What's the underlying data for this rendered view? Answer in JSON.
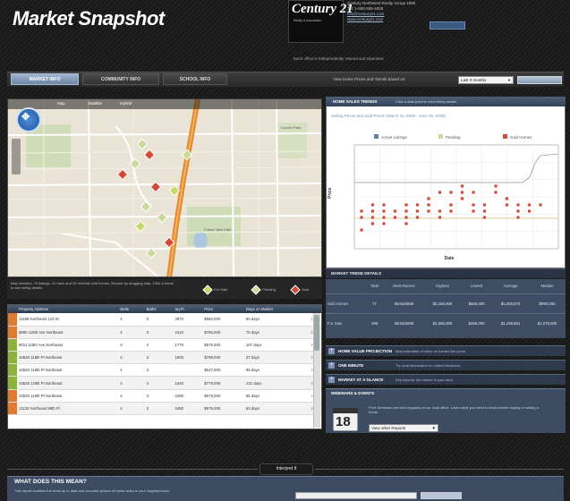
{
  "header": {
    "title": "Market Snapshot",
    "logo_text": "Century 21",
    "logo_sub": "Realty & Associates",
    "agent_lines": [
      "Century Northwest Realty Group 1980",
      "Tel: 1-800-555-4925"
    ],
    "agent_links": [
      "info@century21.com",
      "www.century21.com"
    ],
    "agent_button": "",
    "office_note": "Each office is Independently Owned and Operated"
  },
  "tabs": [
    {
      "label": "MARKET INFO",
      "active": true
    },
    {
      "label": "COMMUNITY INFO",
      "active": false
    },
    {
      "label": "SCHOOL INFO",
      "active": false
    }
  ],
  "range": {
    "label": "View Home Prices and Trends based on:",
    "selected": "Last 3 months",
    "update_label": ""
  },
  "map": {
    "tabs": [
      "Map",
      "Satellite",
      "Hybrid"
    ],
    "place_labels": [
      "Lincoln Park",
      "Forest View Park"
    ],
    "footer_text": "Map includes: 75 listings, 41 have and 20 recently sold homes. Browse by dragging map. Click a home to see listing details.",
    "legend": [
      {
        "label": "For Sale",
        "color": "#c7d66a"
      },
      {
        "label": "Pending",
        "color": "#cbd99a"
      },
      {
        "label": "Sold",
        "color": "#d14a3a"
      }
    ]
  },
  "chart_panel": {
    "header": "HOME SALES TRENDS",
    "header_sub": "Click a data point to view listing details.",
    "title": "Selling Prices and Sold Prices (March 31, 2009 - June 30, 2009)"
  },
  "chart_data": {
    "type": "scatter",
    "title": "Selling Prices and Sold Prices (March 31, 2009 - June 30, 2009)",
    "xlabel": "Date",
    "ylabel": "Price",
    "legend_position": "top",
    "series": [
      {
        "name": "Active Listings",
        "color": "#6b7f9f",
        "points": []
      },
      {
        "name": "Pending",
        "color": "#cbd99a",
        "points": []
      },
      {
        "name": "Sold Homes",
        "color": "#d14a3a",
        "points": [
          [
            1,
            3
          ],
          [
            1,
            5
          ],
          [
            1,
            6
          ],
          [
            2,
            4
          ],
          [
            2,
            5
          ],
          [
            2,
            6
          ],
          [
            2,
            7
          ],
          [
            3,
            4
          ],
          [
            3,
            5
          ],
          [
            3,
            6
          ],
          [
            3,
            7
          ],
          [
            4,
            5
          ],
          [
            4,
            6
          ],
          [
            5,
            4
          ],
          [
            5,
            5
          ],
          [
            5,
            6
          ],
          [
            5,
            7
          ],
          [
            6,
            5
          ],
          [
            6,
            6
          ],
          [
            6,
            7
          ],
          [
            7,
            6
          ],
          [
            7,
            7
          ],
          [
            7,
            8
          ],
          [
            8,
            5
          ],
          [
            8,
            6
          ],
          [
            8,
            9
          ],
          [
            9,
            6
          ],
          [
            9,
            7
          ],
          [
            9,
            9
          ],
          [
            10,
            8
          ],
          [
            10,
            9
          ],
          [
            10,
            10
          ],
          [
            11,
            6
          ],
          [
            11,
            7
          ],
          [
            11,
            9
          ],
          [
            12,
            5
          ],
          [
            12,
            6
          ],
          [
            12,
            7
          ],
          [
            13,
            9
          ],
          [
            13,
            10
          ],
          [
            14,
            7
          ],
          [
            14,
            8
          ],
          [
            15,
            5
          ],
          [
            15,
            6
          ],
          [
            15,
            7
          ],
          [
            16,
            6
          ],
          [
            16,
            7
          ],
          [
            17,
            7
          ]
        ]
      }
    ],
    "grid": true
  },
  "trend": {
    "header": "MARKET TREND DETAILS",
    "columns": [
      "",
      "Total",
      "Most Recent",
      "Highest",
      "Lowest",
      "Average",
      "Median"
    ],
    "rows": [
      [
        "Sold Homes",
        "77",
        "06/15/2009",
        "$2,150,000",
        "$565,000",
        "$1,050,670",
        "$990,000"
      ],
      [
        "For Sale",
        "199",
        "06/15/2009",
        "$2,595,000",
        "$499,000",
        "$1,185,861",
        "$1,075,000"
      ]
    ]
  },
  "info_rows": [
    {
      "label": "HOME VALUE PROJECTION",
      "desc": "Best estimates of value on homes like yours"
    },
    {
      "label": "ONE MINUTE",
      "desc": "Try local information on related decisions"
    },
    {
      "label": "MARKET AT A GLANCE",
      "desc": "Key data for the market in your area"
    }
  ],
  "webinar": {
    "header": "WEBINARS & EVENTS",
    "day": "18",
    "desc": "Free Seminars are held regularly at our local office. Learn what you need to know before buying or selling a home.",
    "select": "View other Reports"
  },
  "listing_table": {
    "headers": [
      "",
      "Property Address",
      "Beds",
      "Baths",
      "Sq.Ft.",
      "Price",
      "Days on Market",
      ""
    ],
    "rows": [
      {
        "status": "#e07a2e",
        "address": "11189 Northeast 123 St",
        "beds": "4",
        "baths": "3",
        "sqft": "2870",
        "price": "$660,000",
        "dom": "60 days"
      },
      {
        "status": "#e07a2e",
        "address": "8890 118th Ave Northeast",
        "beds": "4",
        "baths": "3",
        "sqft": "2410",
        "price": "$755,000",
        "dom": "75 days"
      },
      {
        "status": "#8cb43a",
        "address": "8011 118th Ave Northeast",
        "beds": "3",
        "baths": "2",
        "sqft": "1770",
        "price": "$575,000",
        "dom": "107 days"
      },
      {
        "status": "#8cb43a",
        "address": "10529 118th Pl Northeast",
        "beds": "4",
        "baths": "3",
        "sqft": "1900",
        "price": "$799,000",
        "dom": "27 days"
      },
      {
        "status": "#8cb43a",
        "address": "10529 118th Pl Northeast",
        "beds": "4",
        "baths": "3",
        "sqft": "",
        "price": "$537,000",
        "dom": "95 days"
      },
      {
        "status": "#8cb43a",
        "address": "10529 118th Pl Northeast",
        "beds": "4",
        "baths": "4",
        "sqft": "1640",
        "price": "$779,000",
        "dom": "131 days"
      },
      {
        "status": "#e07a2e",
        "address": "10529 118th Pl Northeast",
        "beds": "4",
        "baths": "3",
        "sqft": "2490",
        "price": "$679,000",
        "dom": "56 days"
      },
      {
        "status": "#e07a2e",
        "address": "11133 Northeast 88th Pl",
        "beds": "4",
        "baths": "3",
        "sqft": "2480",
        "price": "$975,000",
        "dom": "63 days"
      }
    ]
  },
  "bottom": {
    "interpret_label": "Interpret It",
    "meaning_title": "WHAT DOES THIS MEAN?",
    "meaning_desc": "This report contains the most up to date and accurate picture of home sales in your neighborhood."
  }
}
